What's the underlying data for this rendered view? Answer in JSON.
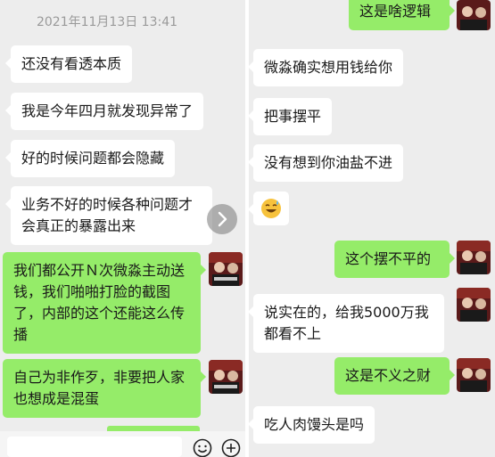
{
  "left": {
    "timestamp": "2021年11月13日 13:41",
    "messages": [
      {
        "side": "in",
        "text": "还没有看透本质"
      },
      {
        "side": "in",
        "text": "我是今年四月就发现异常了"
      },
      {
        "side": "in",
        "text": "好的时候问题都会隐藏"
      },
      {
        "side": "in",
        "text": "业务不好的时候各种问题才\n会真正的暴露出来"
      },
      {
        "side": "out",
        "text": "我们都公开Ｎ次微淼主动送\n钱，我们啪啪打脸的截图\n了，内部的这个还能这么传\n播"
      },
      {
        "side": "out",
        "text": "自己为非作歹，非要把人家\n也想成是混蛋"
      }
    ],
    "scroll_icon": "chevron-right-icon",
    "input_icons": [
      "emoji-icon",
      "plus-icon"
    ]
  },
  "right": {
    "messages": [
      {
        "side": "out",
        "text": "这是啥逻辑"
      },
      {
        "side": "in",
        "text": "微淼确实想用钱给你"
      },
      {
        "side": "in",
        "text": "把事摆平"
      },
      {
        "side": "in",
        "text": "没有想到你油盐不进"
      },
      {
        "side": "in",
        "text": "",
        "emoji": "sweat-smile-emoji-icon"
      },
      {
        "side": "out",
        "text": "这个摆不平的"
      },
      {
        "side": "in",
        "text": "说实在的，给我5000万我\n都看不上"
      },
      {
        "side": "out",
        "text": "这是不义之财"
      },
      {
        "side": "in",
        "text": "吃人肉馒头是吗"
      }
    ]
  },
  "colors": {
    "bg": "#ededed",
    "in_bubble": "#ffffff",
    "out_bubble": "#95ec69"
  }
}
